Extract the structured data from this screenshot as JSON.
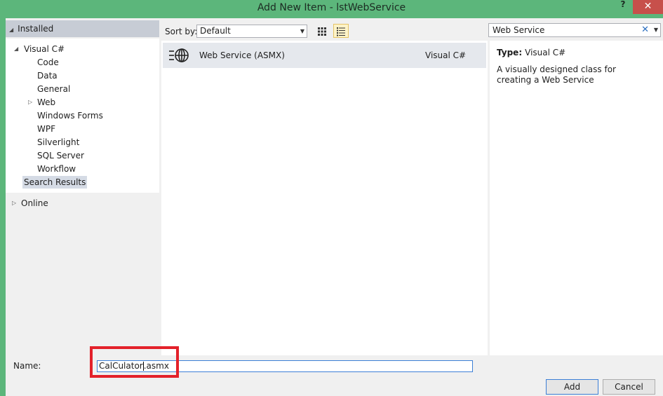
{
  "window": {
    "title": "Add New Item - lstWebService",
    "help_label": "?",
    "close_label": "✕"
  },
  "left_pane": {
    "installed_label": "Installed",
    "tree": [
      {
        "label": "Visual C#",
        "expander": "◢"
      },
      {
        "label": "Code"
      },
      {
        "label": "Data"
      },
      {
        "label": "General"
      },
      {
        "label": "Web",
        "expander": "▷"
      },
      {
        "label": "Windows Forms"
      },
      {
        "label": "WPF"
      },
      {
        "label": "Silverlight"
      },
      {
        "label": "SQL Server"
      },
      {
        "label": "Workflow"
      },
      {
        "label": "Search Results",
        "selected": true
      }
    ],
    "online_label": "Online"
  },
  "toolbar": {
    "sort_label": "Sort by:",
    "sort_value": "Default"
  },
  "templates": [
    {
      "name": "Web Service (ASMX)",
      "language": "Visual C#",
      "icon": "web-service-icon"
    }
  ],
  "search": {
    "value": "Web Service"
  },
  "details": {
    "type_label": "Type:",
    "type_value": "Visual C#",
    "description": "A visually designed class for creating a Web Service"
  },
  "bottom": {
    "name_label": "Name:",
    "name_value_before_caret": "CalCulator",
    "name_value_after_caret": ".asmx",
    "add_label": "Add",
    "cancel_label": "Cancel"
  },
  "colors": {
    "title_bar": "#5cb67b",
    "close_button": "#c7504b",
    "selection": "#d5dbe5",
    "highlight_box": "#e3212a"
  }
}
